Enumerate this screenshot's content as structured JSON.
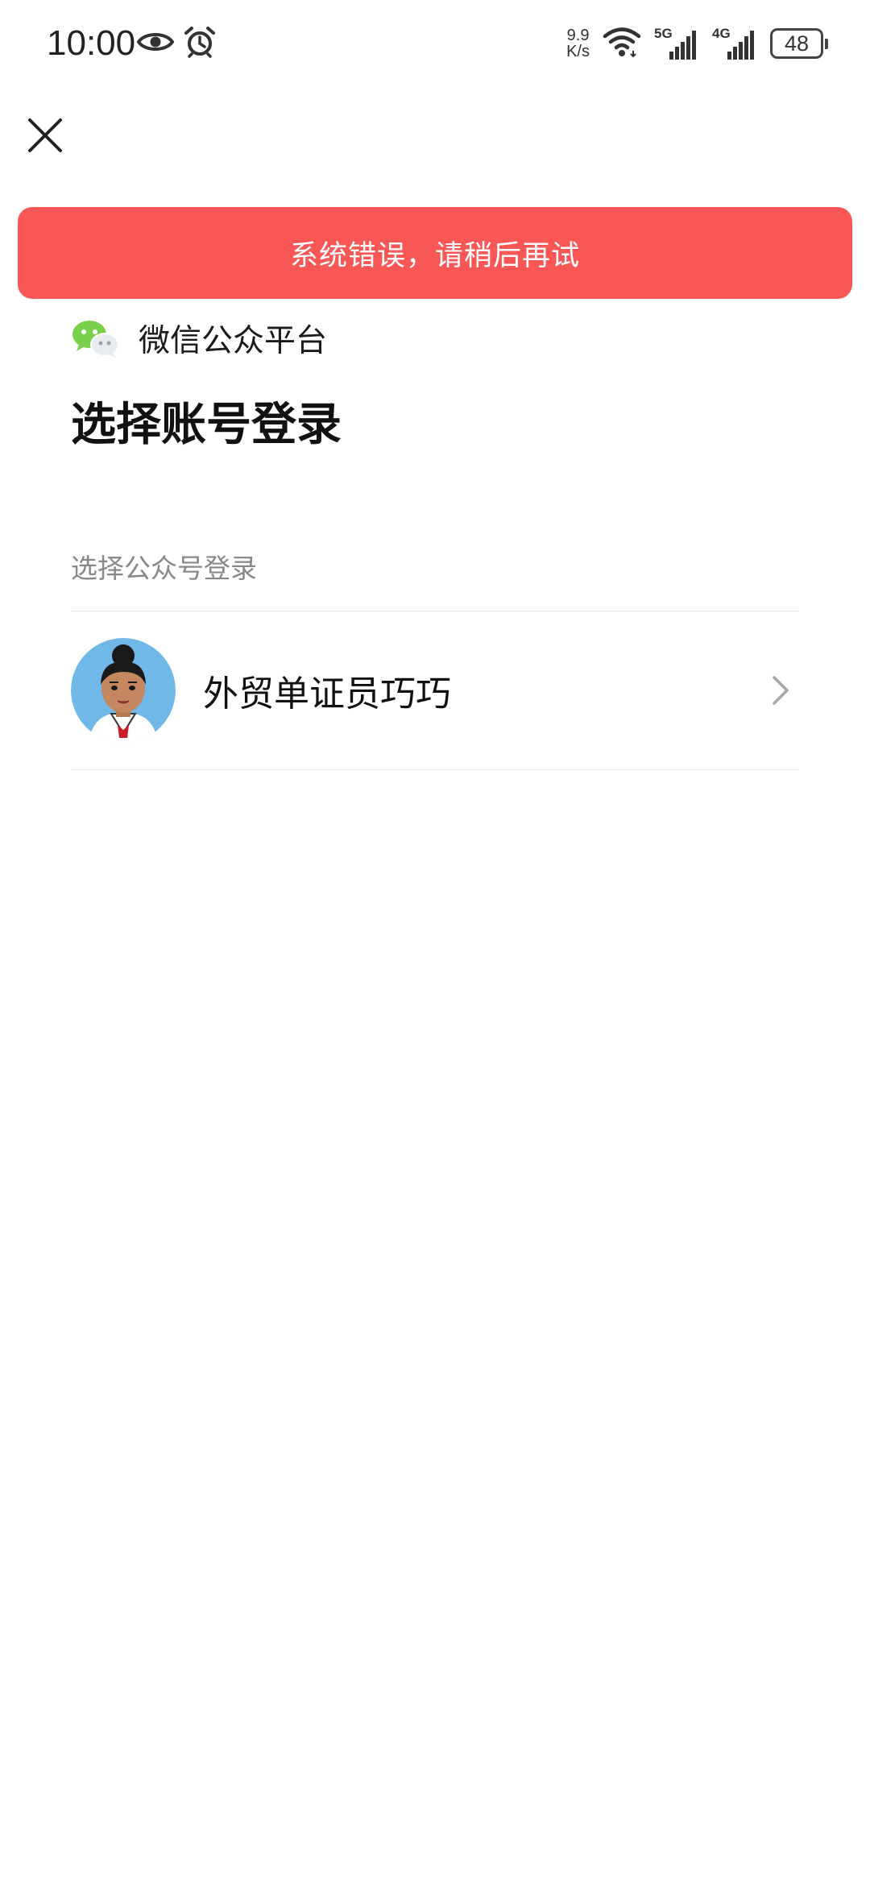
{
  "status_bar": {
    "time": "10:00",
    "net_speed_value": "9.9",
    "net_speed_unit": "K/s",
    "sim1_label": "5G",
    "sim2_label": "4G",
    "battery_level": "48",
    "icons": [
      "eye-icon",
      "alarm-icon",
      "wifi-icon",
      "signal-5g-icon",
      "signal-4g-icon",
      "battery-icon"
    ]
  },
  "toolbar": {
    "close_icon": "close-icon"
  },
  "error_toast": {
    "message": "系统错误，请稍后再试",
    "color": "#f95656"
  },
  "brand": {
    "icon": "wechat-icon",
    "name": "微信公众平台"
  },
  "page": {
    "title": "选择账号登录",
    "section_label": "选择公众号登录"
  },
  "accounts": [
    {
      "name": "外贸单证员巧巧",
      "avatar_icon": "avatar-cartoon-woman",
      "chevron_icon": "chevron-right-icon"
    }
  ]
}
